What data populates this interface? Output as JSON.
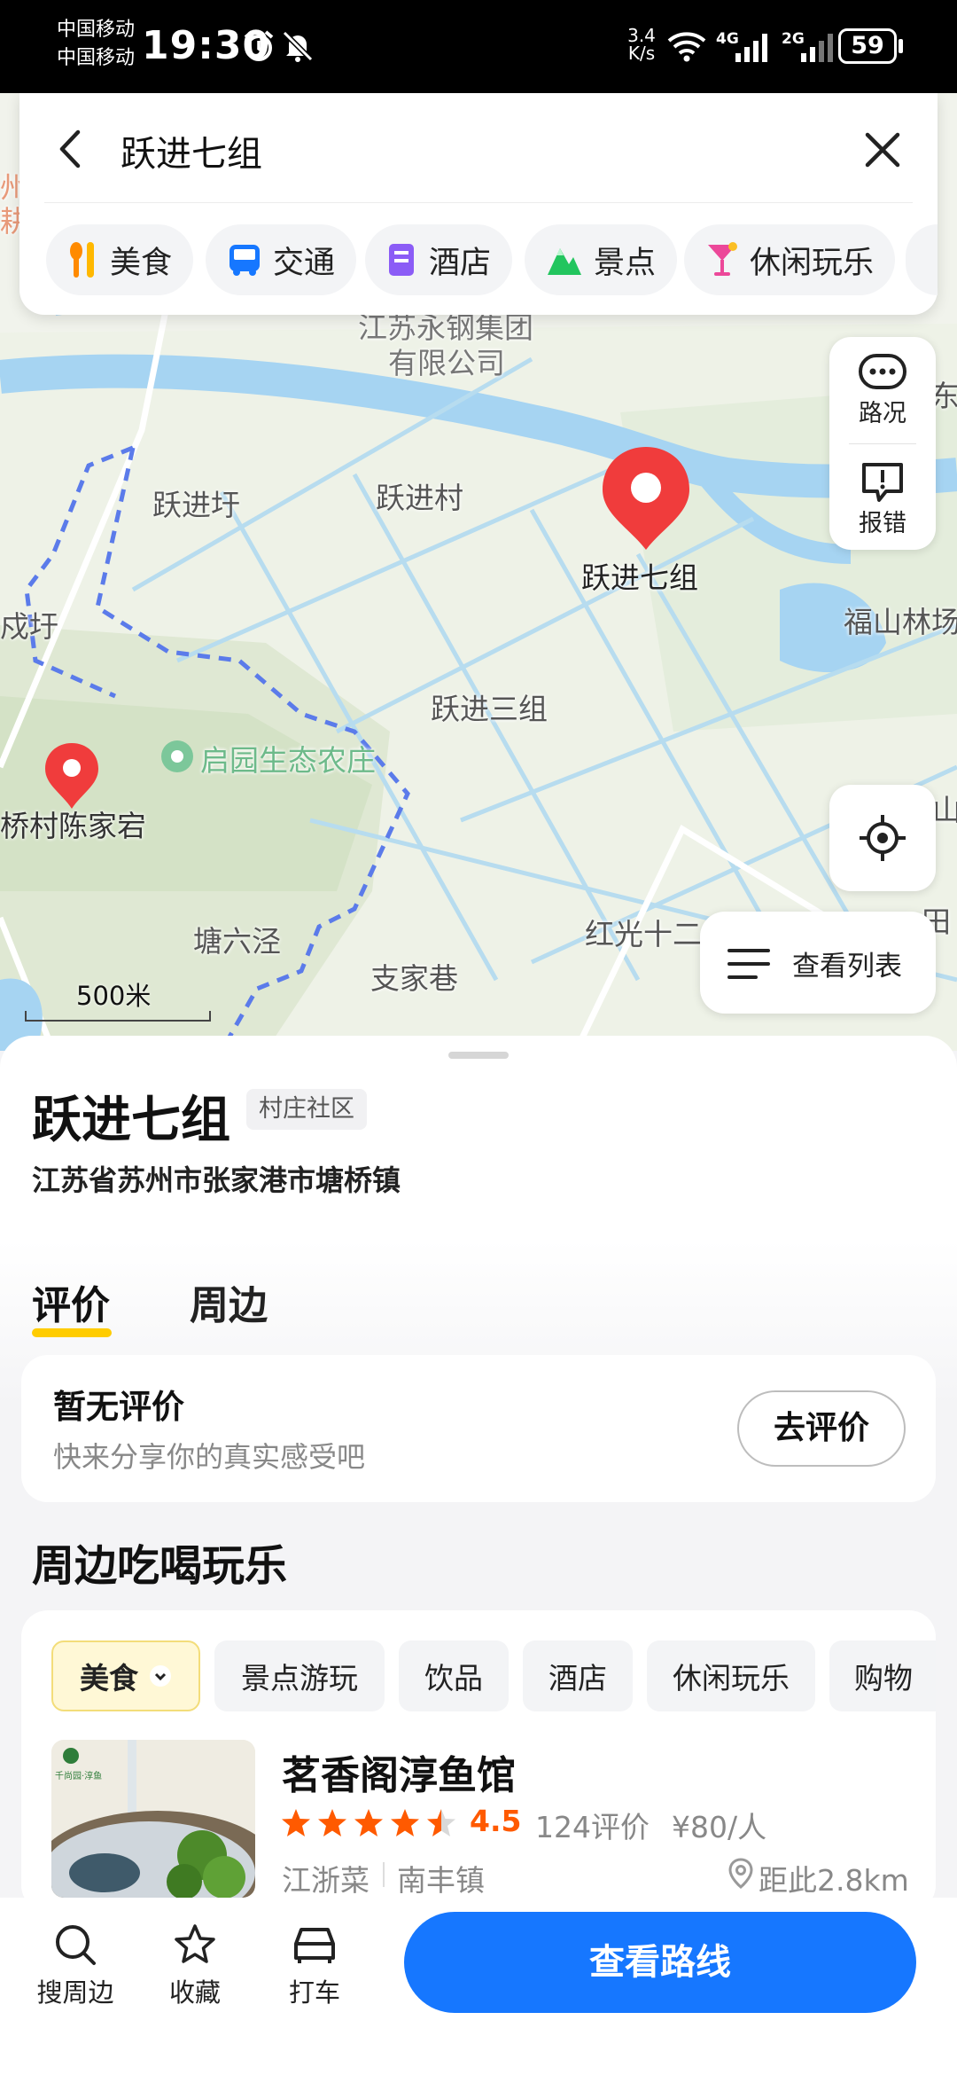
{
  "status_bar": {
    "carrier_1": "中国移动",
    "carrier_2": "中国移动",
    "time": "19:30",
    "net_speed_value": "3.4",
    "net_speed_unit": "K/s",
    "net_4g": "4G",
    "net_2g": "2G",
    "battery": "59"
  },
  "search": {
    "query": "跃进七组",
    "categories": [
      {
        "label": "美食",
        "icon": "fork-knife-icon"
      },
      {
        "label": "交通",
        "icon": "bus-icon"
      },
      {
        "label": "酒店",
        "icon": "hotel-icon"
      },
      {
        "label": "景点",
        "icon": "mountain-icon"
      },
      {
        "label": "休闲玩乐",
        "icon": "cocktail-icon"
      }
    ]
  },
  "map": {
    "labels": {
      "company_1": "江苏永钢集团",
      "company_2": "有限公司",
      "place_1": "跃进圩",
      "place_2": "跃进村",
      "place_3": "跃进三组",
      "place_4": "福山林场",
      "place_5": "戍圩",
      "place_6": "启园生态农庄",
      "place_7": "桥村陈家宕",
      "place_8": "塘六泾",
      "place_9": "支家巷",
      "place_10": "红光十二",
      "edge_left_1": "州",
      "edge_left_2": "耕",
      "edge_right_1": "东",
      "edge_right_2": "山",
      "edge_right_3": "田"
    },
    "pin_label": "跃进七组",
    "scale": "500米",
    "controls": {
      "traffic": "路况",
      "report": "报错",
      "list": "查看列表"
    }
  },
  "place": {
    "name": "跃进七组",
    "tag": "村庄社区",
    "address": "江苏省苏州市张家港市塘桥镇",
    "tabs": [
      "评价",
      "周边"
    ],
    "active_tab": "评价"
  },
  "review": {
    "title": "暂无评价",
    "subtitle": "快来分享你的真实感受吧",
    "button": "去评价"
  },
  "nearby": {
    "title": "周边吃喝玩乐",
    "filters": [
      "美食",
      "景点游玩",
      "饮品",
      "酒店",
      "休闲玩乐",
      "购物"
    ],
    "active_filter": "美食",
    "item": {
      "name": "茗香阁淳鱼馆",
      "rating": "4.5",
      "rating_value": 4.5,
      "reviews": "124评价",
      "price": "¥80/人",
      "cuisine": "江浙菜",
      "area": "南丰镇",
      "distance": "距此2.8km",
      "thumb_text_1": "千尚园·淳鱼"
    }
  },
  "bottom_bar": {
    "search_nearby": "搜周边",
    "favorite": "收藏",
    "taxi": "打车",
    "route": "查看路线"
  },
  "colors": {
    "accent_blue": "#1677ff",
    "star_orange": "#ff5a00",
    "tab_underline": "#ffcc00",
    "pin_red": "#f03c3c",
    "boundary_blue": "#5b7bea"
  }
}
